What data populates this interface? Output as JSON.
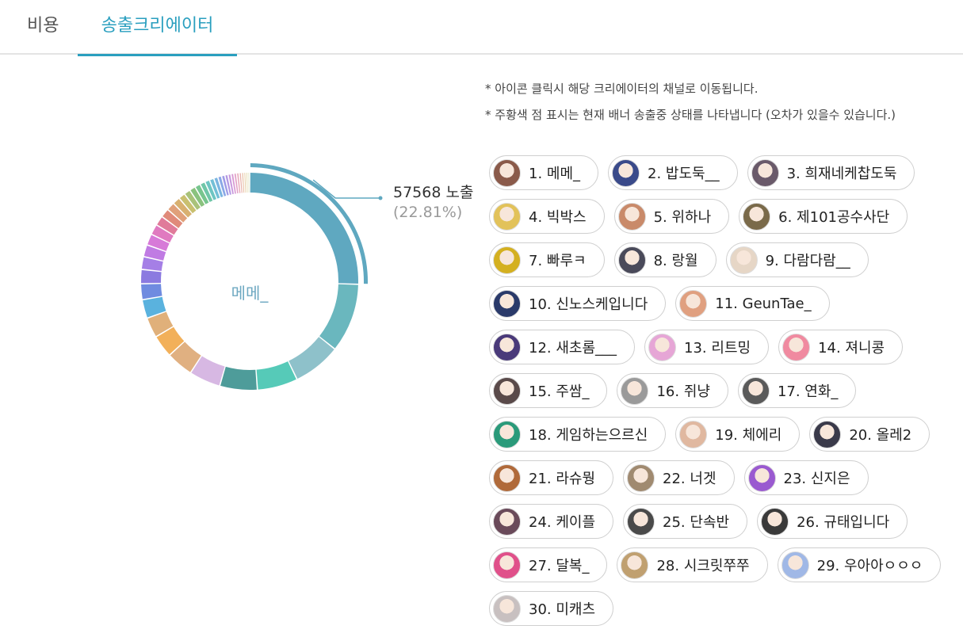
{
  "tabs": [
    {
      "label": "비용",
      "active": false
    },
    {
      "label": "송출크리에이터",
      "active": true
    }
  ],
  "chart_data": {
    "type": "pie",
    "donut": true,
    "center_label": "메메_",
    "highlight": {
      "value_label": "57568 노출",
      "percent_label": "(22.81%)"
    },
    "values": [
      22.81,
      9.2,
      6.4,
      5.4,
      5.0,
      4.2,
      3.6,
      3.0,
      2.7,
      2.5,
      2.1,
      1.9,
      1.7,
      1.6,
      1.5,
      1.4,
      1.3,
      1.2,
      1.1,
      1.0,
      0.9,
      0.85,
      0.8,
      0.75,
      0.7,
      0.65,
      0.6,
      0.55,
      0.5,
      0.45,
      0.42,
      0.4,
      0.38,
      0.36,
      0.34,
      0.32,
      0.3,
      0.28,
      0.26,
      0.24
    ],
    "colors": [
      "#5fa8c0",
      "#6ab7be",
      "#8ec1ca",
      "#56cab8",
      "#4e9c9a",
      "#d7b8e3",
      "#e0b081",
      "#f2b05a",
      "#e0b07a",
      "#5ab2de",
      "#6f8be0",
      "#8b7ae0",
      "#a57fe6",
      "#c07be3",
      "#d77ad8",
      "#e07ac0",
      "#e07b9a",
      "#e08a7a",
      "#e0a07a",
      "#d8b070",
      "#c9c070",
      "#a9c27a",
      "#8ac27e",
      "#77c58e",
      "#6fc6a8",
      "#6dc5c2",
      "#72bfd6",
      "#7ab5e0",
      "#8aa8e6",
      "#9f9be6",
      "#b398e3",
      "#c898dd",
      "#d89ad3",
      "#e2a0c6",
      "#e6a8b8",
      "#e8b3ab",
      "#e8bfa3",
      "#e6cba0",
      "#e0d4a3",
      "#d6daa8"
    ]
  },
  "notes": [
    "* 아이콘 클릭시 해당 크리에이터의 채널로 이동됩니다.",
    "* 주황색 점 표시는 현재 배너 송출중 상태를 나타냅니다 (오차가 있을수 있습니다.)"
  ],
  "creators": [
    {
      "label": "1. 메메_",
      "color": "#8a5a4a"
    },
    {
      "label": "2. 밥도둑__",
      "color": "#3a4a8a"
    },
    {
      "label": "3. 희재네케찹도둑",
      "color": "#6a5a6a"
    },
    {
      "label": "4. 빅박스",
      "color": "#e2c25a"
    },
    {
      "label": "5. 위하나",
      "color": "#c98a6a"
    },
    {
      "label": "6. 제101공수사단",
      "color": "#7a6a4a"
    },
    {
      "label": "7. 빠루ㅋ",
      "color": "#d4b020"
    },
    {
      "label": "8. 랑월",
      "color": "#4a4a5a"
    },
    {
      "label": "9. 다람다람__",
      "color": "#e6d6c6"
    },
    {
      "label": "10. 신노스케입니다",
      "color": "#2a3a6a"
    },
    {
      "label": "11. GeunTae_",
      "color": "#e0a080"
    },
    {
      "label": "12. 새초롬___",
      "color": "#4a3a7a"
    },
    {
      "label": "13. 리트밍",
      "color": "#e6a6d6"
    },
    {
      "label": "14. 져니콩",
      "color": "#f08aa0"
    },
    {
      "label": "15. 주쌈_",
      "color": "#5a4a4a"
    },
    {
      "label": "16. 쥐냥",
      "color": "#9a9a9a"
    },
    {
      "label": "17. 연화_",
      "color": "#5a5a5a"
    },
    {
      "label": "18. 게임하는으르신",
      "color": "#2a9a7a"
    },
    {
      "label": "19. 체에리",
      "color": "#e0b8a0"
    },
    {
      "label": "20. 올레2",
      "color": "#3a3a4a"
    },
    {
      "label": "21. 라슈뭥",
      "color": "#b06a3a"
    },
    {
      "label": "22. 너겟",
      "color": "#a08a70"
    },
    {
      "label": "23. 신지은",
      "color": "#9a5ad0"
    },
    {
      "label": "24. 케이플",
      "color": "#6a4a5a"
    },
    {
      "label": "25. 단속반",
      "color": "#4a4a4a"
    },
    {
      "label": "26. 규태입니다",
      "color": "#3a3a3a"
    },
    {
      "label": "27. 달복_",
      "color": "#e0508a"
    },
    {
      "label": "28. 시크릿쭈쭈",
      "color": "#c0a070"
    },
    {
      "label": "29. 우아아ㅇㅇㅇ",
      "color": "#a0b8e6"
    },
    {
      "label": "30. 미캐츠",
      "color": "#c8c0c0"
    }
  ]
}
